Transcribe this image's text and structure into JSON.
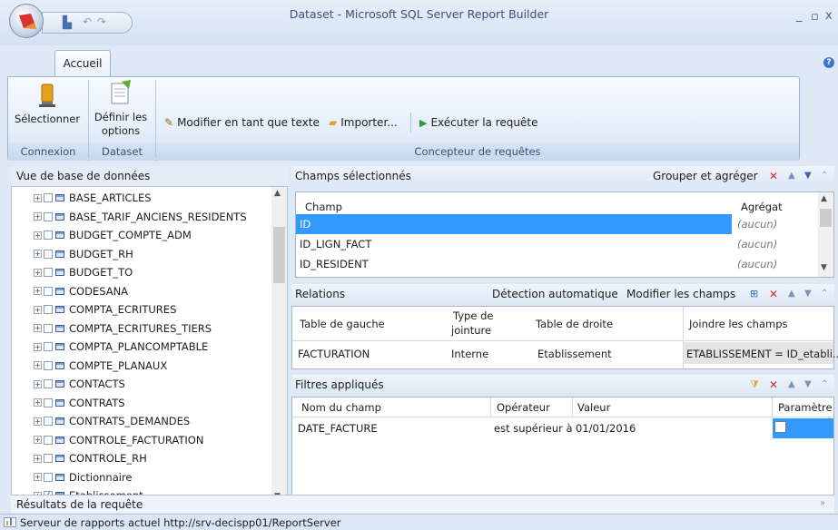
{
  "window": {
    "title": "Dataset - Microsoft SQL Server Report Builder",
    "minimize": "_",
    "restore": "▫",
    "close": "x"
  },
  "ribbon": {
    "tab": "Accueil",
    "help": "?",
    "selectionner": "Sélectionner",
    "definir_line1": "Définir les",
    "definir_line2": "options",
    "modifier_texte": "Modifier en tant que texte",
    "importer": "Importer...",
    "executer": "Exécuter la requête",
    "groups": {
      "connexion": "Connexion",
      "dataset": "Dataset",
      "concepteur": "Concepteur de requêtes"
    }
  },
  "db_view": {
    "title": "Vue de base de données",
    "items": [
      {
        "label": "BASE_ARTICLES",
        "checked": false
      },
      {
        "label": "BASE_TARIF_ANCIENS_RESIDENTS",
        "checked": false
      },
      {
        "label": "BUDGET_COMPTE_ADM",
        "checked": false
      },
      {
        "label": "BUDGET_RH",
        "checked": false
      },
      {
        "label": "BUDGET_TO",
        "checked": false
      },
      {
        "label": "CODESANA",
        "checked": false
      },
      {
        "label": "COMPTA_ECRITURES",
        "checked": false
      },
      {
        "label": "COMPTA_ECRITURES_TIERS",
        "checked": false
      },
      {
        "label": "COMPTA_PLANCOMPTABLE",
        "checked": false
      },
      {
        "label": "COMPTE_PLANAUX",
        "checked": false
      },
      {
        "label": "CONTACTS",
        "checked": false
      },
      {
        "label": "CONTRATS",
        "checked": false
      },
      {
        "label": "CONTRATS_DEMANDES",
        "checked": false
      },
      {
        "label": "CONTROLE_FACTURATION",
        "checked": false
      },
      {
        "label": "CONTROLE_RH",
        "checked": false
      },
      {
        "label": "Dictionnaire",
        "checked": false
      },
      {
        "label": "Etablissement",
        "checked": true
      }
    ]
  },
  "fields": {
    "title": "Champs sélectionnés",
    "group_label": "Grouper et agréger",
    "col_champ": "Champ",
    "col_agregat": "Agrégat",
    "rows": [
      {
        "champ": "ID",
        "agregat": "(aucun)",
        "selected": true
      },
      {
        "champ": "ID_LIGN_FACT",
        "agregat": "(aucun)",
        "selected": false
      },
      {
        "champ": "ID_RESIDENT",
        "agregat": "(aucun)",
        "selected": false
      }
    ]
  },
  "relations": {
    "title": "Relations",
    "auto_detect": "Détection automatique",
    "modify_fields": "Modifier les champs",
    "col_left": "Table de gauche",
    "col_type1": "Type de",
    "col_type2": "jointure",
    "col_right": "Table de droite",
    "col_join": "Joindre les champs",
    "rows": [
      {
        "left": "FACTURATION",
        "type": "Interne",
        "right": "Etablissement",
        "join": "ETABLISSEMENT = ID_etabli..."
      }
    ]
  },
  "filters": {
    "title": "Filtres appliqués",
    "col_name": "Nom du champ",
    "col_op": "Opérateur",
    "col_value": "Valeur",
    "col_param": "Paramètre",
    "rows": [
      {
        "name": "DATE_FACTURE",
        "op": "est supérieur à",
        "value": "01/01/2016",
        "param": false
      }
    ]
  },
  "results": {
    "title": "Résultats de la requête"
  },
  "status": {
    "text": "Serveur de rapports actuel http://srv-decispp01/ReportServer"
  }
}
